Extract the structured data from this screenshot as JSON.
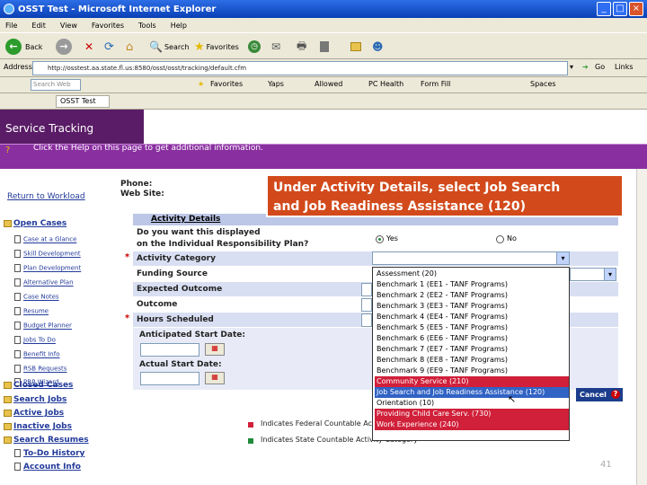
{
  "window": {
    "title": "OSST Test - Microsoft Internet Explorer",
    "minimize": "_",
    "maximize": "□",
    "close": "×"
  },
  "menu": [
    "File",
    "Edit",
    "View",
    "Favorites",
    "Tools",
    "Help"
  ],
  "toolbar": {
    "back": "Back",
    "search": "Search",
    "favorites": "Favorites"
  },
  "address": {
    "label": "Address",
    "url": "http://osstest.aa.state.fl.us:8580/osst/osst/tracking/default.cfm",
    "go": "Go",
    "links": "Links"
  },
  "links_bar": {
    "search_label": "Search Web",
    "favorites": "Favorites",
    "yaps": "Yaps",
    "allowed": "Allowed",
    "pc_health": "PC Health",
    "form_fill": "Form Fill",
    "spaces": "Spaces"
  },
  "tab": {
    "label": "OSST Test"
  },
  "header": {
    "title": "Service Tracking",
    "help": "Click the Help on this page to get additional information."
  },
  "contact": {
    "phone_label": "Phone:",
    "web_label": "Web Site:"
  },
  "sidebar": {
    "return": "Return to Workload",
    "open_cases": "Open Cases",
    "items": [
      "Case at a Glance",
      "Skill Development",
      "Plan Development",
      "Alternative Plan",
      "Case Notes",
      "Resume",
      "Budget Planner",
      "Jobs To Do",
      "Benefit Info",
      "RSB Requests",
      "PRP Wizard"
    ],
    "folders": [
      "Closed Cases",
      "Search Jobs",
      "Active Jobs",
      "Inactive Jobs",
      "Search Resumes",
      "To-Do History",
      "Account Info"
    ]
  },
  "form": {
    "section_title": "Activity Details",
    "question_line1": "Do you want this displayed",
    "question_line2": "on the Individual Responsibility Plan?",
    "yes": "Yes",
    "no": "No",
    "activity_category": "Activity Category",
    "funding_source": "Funding Source",
    "expected_outcome": "Expected Outcome",
    "outcome": "Outcome",
    "hours_scheduled": "Hours Scheduled",
    "anticipated_start": "Anticipated Start Date:",
    "actual_start": "Actual Start Date:",
    "required_mark": "*"
  },
  "callout": {
    "line1": "Under Activity Details, select Job Search",
    "line2": "and Job Readiness Assistance (120)"
  },
  "dropdown_options": [
    "Assessment (20)",
    "Benchmark 1 (EE1 - TANF Programs)",
    "Benchmark 2 (EE2 - TANF Programs)",
    "Benchmark 3 (EE3 - TANF Programs)",
    "Benchmark 4 (EE4 - TANF Programs)",
    "Benchmark 5 (EE5 - TANF Programs)",
    "Benchmark 6 (EE6 - TANF Programs)",
    "Benchmark 7 (EE7 - TANF Programs)",
    "Benchmark 8 (EE8 - TANF Programs)",
    "Benchmark 9 (EE9 - TANF Programs)",
    "Community Service (210)",
    "Job Search and Job Readiness Assistance (120)",
    "Orientation (10)",
    "Providing Child Care Serv. (730)",
    "Work Experience (240)"
  ],
  "legend": {
    "federal": "Indicates Federal Countable Activity Category",
    "state": "Indicates State Countable Activity Category"
  },
  "buttons": {
    "cancel": "Cancel"
  },
  "slide_number": "41",
  "colors": {
    "header": "#5a1c66",
    "helpbar": "#8a2fa0",
    "callout": "#d24a1b",
    "federal": "#d0203a",
    "state": "#1e8a3a",
    "selected": "#3163c5"
  }
}
